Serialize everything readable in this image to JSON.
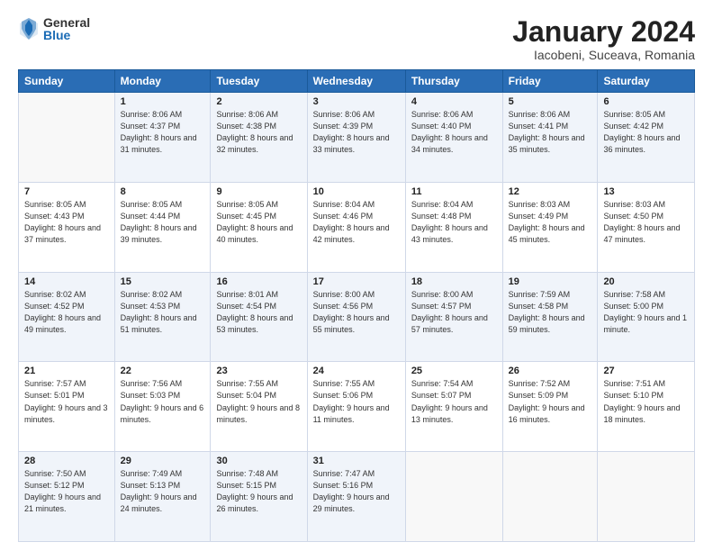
{
  "header": {
    "logo_general": "General",
    "logo_blue": "Blue",
    "month_title": "January 2024",
    "location": "Iacobeni, Suceava, Romania"
  },
  "days_of_week": [
    "Sunday",
    "Monday",
    "Tuesday",
    "Wednesday",
    "Thursday",
    "Friday",
    "Saturday"
  ],
  "weeks": [
    [
      {
        "day": "",
        "sunrise": "",
        "sunset": "",
        "daylight": ""
      },
      {
        "day": "1",
        "sunrise": "Sunrise: 8:06 AM",
        "sunset": "Sunset: 4:37 PM",
        "daylight": "Daylight: 8 hours and 31 minutes."
      },
      {
        "day": "2",
        "sunrise": "Sunrise: 8:06 AM",
        "sunset": "Sunset: 4:38 PM",
        "daylight": "Daylight: 8 hours and 32 minutes."
      },
      {
        "day": "3",
        "sunrise": "Sunrise: 8:06 AM",
        "sunset": "Sunset: 4:39 PM",
        "daylight": "Daylight: 8 hours and 33 minutes."
      },
      {
        "day": "4",
        "sunrise": "Sunrise: 8:06 AM",
        "sunset": "Sunset: 4:40 PM",
        "daylight": "Daylight: 8 hours and 34 minutes."
      },
      {
        "day": "5",
        "sunrise": "Sunrise: 8:06 AM",
        "sunset": "Sunset: 4:41 PM",
        "daylight": "Daylight: 8 hours and 35 minutes."
      },
      {
        "day": "6",
        "sunrise": "Sunrise: 8:05 AM",
        "sunset": "Sunset: 4:42 PM",
        "daylight": "Daylight: 8 hours and 36 minutes."
      }
    ],
    [
      {
        "day": "7",
        "sunrise": "Sunrise: 8:05 AM",
        "sunset": "Sunset: 4:43 PM",
        "daylight": "Daylight: 8 hours and 37 minutes."
      },
      {
        "day": "8",
        "sunrise": "Sunrise: 8:05 AM",
        "sunset": "Sunset: 4:44 PM",
        "daylight": "Daylight: 8 hours and 39 minutes."
      },
      {
        "day": "9",
        "sunrise": "Sunrise: 8:05 AM",
        "sunset": "Sunset: 4:45 PM",
        "daylight": "Daylight: 8 hours and 40 minutes."
      },
      {
        "day": "10",
        "sunrise": "Sunrise: 8:04 AM",
        "sunset": "Sunset: 4:46 PM",
        "daylight": "Daylight: 8 hours and 42 minutes."
      },
      {
        "day": "11",
        "sunrise": "Sunrise: 8:04 AM",
        "sunset": "Sunset: 4:48 PM",
        "daylight": "Daylight: 8 hours and 43 minutes."
      },
      {
        "day": "12",
        "sunrise": "Sunrise: 8:03 AM",
        "sunset": "Sunset: 4:49 PM",
        "daylight": "Daylight: 8 hours and 45 minutes."
      },
      {
        "day": "13",
        "sunrise": "Sunrise: 8:03 AM",
        "sunset": "Sunset: 4:50 PM",
        "daylight": "Daylight: 8 hours and 47 minutes."
      }
    ],
    [
      {
        "day": "14",
        "sunrise": "Sunrise: 8:02 AM",
        "sunset": "Sunset: 4:52 PM",
        "daylight": "Daylight: 8 hours and 49 minutes."
      },
      {
        "day": "15",
        "sunrise": "Sunrise: 8:02 AM",
        "sunset": "Sunset: 4:53 PM",
        "daylight": "Daylight: 8 hours and 51 minutes."
      },
      {
        "day": "16",
        "sunrise": "Sunrise: 8:01 AM",
        "sunset": "Sunset: 4:54 PM",
        "daylight": "Daylight: 8 hours and 53 minutes."
      },
      {
        "day": "17",
        "sunrise": "Sunrise: 8:00 AM",
        "sunset": "Sunset: 4:56 PM",
        "daylight": "Daylight: 8 hours and 55 minutes."
      },
      {
        "day": "18",
        "sunrise": "Sunrise: 8:00 AM",
        "sunset": "Sunset: 4:57 PM",
        "daylight": "Daylight: 8 hours and 57 minutes."
      },
      {
        "day": "19",
        "sunrise": "Sunrise: 7:59 AM",
        "sunset": "Sunset: 4:58 PM",
        "daylight": "Daylight: 8 hours and 59 minutes."
      },
      {
        "day": "20",
        "sunrise": "Sunrise: 7:58 AM",
        "sunset": "Sunset: 5:00 PM",
        "daylight": "Daylight: 9 hours and 1 minute."
      }
    ],
    [
      {
        "day": "21",
        "sunrise": "Sunrise: 7:57 AM",
        "sunset": "Sunset: 5:01 PM",
        "daylight": "Daylight: 9 hours and 3 minutes."
      },
      {
        "day": "22",
        "sunrise": "Sunrise: 7:56 AM",
        "sunset": "Sunset: 5:03 PM",
        "daylight": "Daylight: 9 hours and 6 minutes."
      },
      {
        "day": "23",
        "sunrise": "Sunrise: 7:55 AM",
        "sunset": "Sunset: 5:04 PM",
        "daylight": "Daylight: 9 hours and 8 minutes."
      },
      {
        "day": "24",
        "sunrise": "Sunrise: 7:55 AM",
        "sunset": "Sunset: 5:06 PM",
        "daylight": "Daylight: 9 hours and 11 minutes."
      },
      {
        "day": "25",
        "sunrise": "Sunrise: 7:54 AM",
        "sunset": "Sunset: 5:07 PM",
        "daylight": "Daylight: 9 hours and 13 minutes."
      },
      {
        "day": "26",
        "sunrise": "Sunrise: 7:52 AM",
        "sunset": "Sunset: 5:09 PM",
        "daylight": "Daylight: 9 hours and 16 minutes."
      },
      {
        "day": "27",
        "sunrise": "Sunrise: 7:51 AM",
        "sunset": "Sunset: 5:10 PM",
        "daylight": "Daylight: 9 hours and 18 minutes."
      }
    ],
    [
      {
        "day": "28",
        "sunrise": "Sunrise: 7:50 AM",
        "sunset": "Sunset: 5:12 PM",
        "daylight": "Daylight: 9 hours and 21 minutes."
      },
      {
        "day": "29",
        "sunrise": "Sunrise: 7:49 AM",
        "sunset": "Sunset: 5:13 PM",
        "daylight": "Daylight: 9 hours and 24 minutes."
      },
      {
        "day": "30",
        "sunrise": "Sunrise: 7:48 AM",
        "sunset": "Sunset: 5:15 PM",
        "daylight": "Daylight: 9 hours and 26 minutes."
      },
      {
        "day": "31",
        "sunrise": "Sunrise: 7:47 AM",
        "sunset": "Sunset: 5:16 PM",
        "daylight": "Daylight: 9 hours and 29 minutes."
      },
      {
        "day": "",
        "sunrise": "",
        "sunset": "",
        "daylight": ""
      },
      {
        "day": "",
        "sunrise": "",
        "sunset": "",
        "daylight": ""
      },
      {
        "day": "",
        "sunrise": "",
        "sunset": "",
        "daylight": ""
      }
    ]
  ]
}
